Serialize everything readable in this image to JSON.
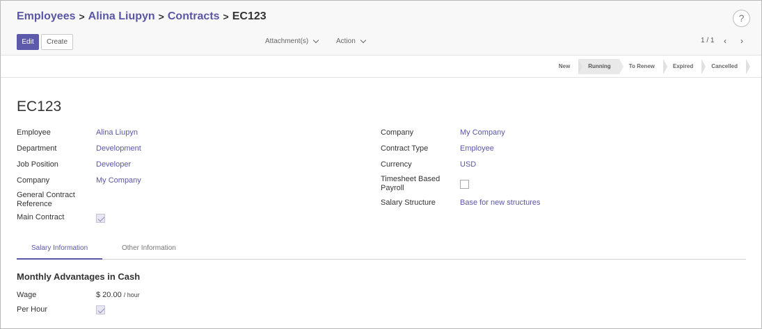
{
  "breadcrumb": {
    "items": [
      "Employees",
      "Alina Liupyn",
      "Contracts"
    ],
    "current": "EC123",
    "separator": ">"
  },
  "toolbar": {
    "edit_label": "Edit",
    "create_label": "Create",
    "attachments_label": "Attachment(s)",
    "action_label": "Action",
    "pager": "1 / 1",
    "help_label": "?"
  },
  "status": {
    "stages": [
      "New",
      "Running",
      "To Renew",
      "Expired",
      "Cancelled"
    ],
    "active": "Running"
  },
  "form": {
    "title": "EC123",
    "left": {
      "employee_label": "Employee",
      "employee_value": "Alina Liupyn",
      "department_label": "Department",
      "department_value": "Development",
      "job_label": "Job Position",
      "job_value": "Developer",
      "company_label": "Company",
      "company_value": "My Company",
      "gcr_label_line1": "General Contract",
      "gcr_label_line2": "Reference",
      "main_contract_label": "Main Contract",
      "main_contract_checked": true
    },
    "right": {
      "company_label": "Company",
      "company_value": "My Company",
      "type_label": "Contract Type",
      "type_value": "Employee",
      "currency_label": "Currency",
      "currency_value": "USD",
      "timesheet_label_line1": "Timesheet Based",
      "timesheet_label_line2": "Payroll",
      "timesheet_checked": false,
      "structure_label": "Salary Structure",
      "structure_value": "Base for new structures"
    }
  },
  "tabs": {
    "salary": "Salary Information",
    "other": "Other Information",
    "active": "Salary Information"
  },
  "salary": {
    "section_title": "Monthly Advantages in Cash",
    "wage_label": "Wage",
    "wage_value": "$ 20.00",
    "wage_unit": "/ hour",
    "per_hour_label": "Per Hour",
    "per_hour_checked": true
  },
  "colors": {
    "accent": "#5e5aab",
    "link": "#5a56a6"
  }
}
